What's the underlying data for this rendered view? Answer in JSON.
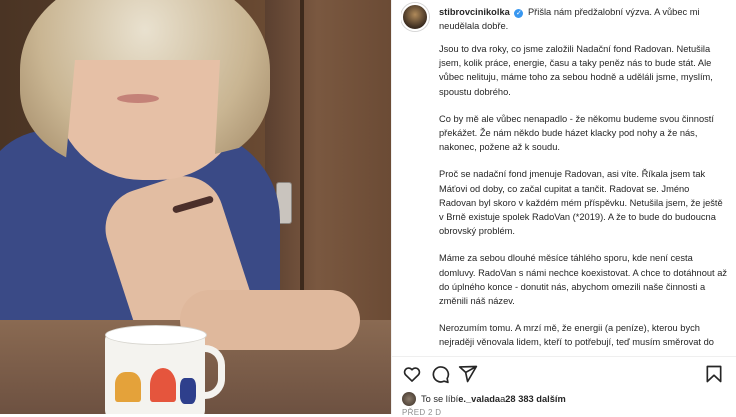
{
  "post": {
    "username": "stibrovcinikolka",
    "verified_icon": "verified-badge-icon",
    "caption_first": "Přišla nám předžalobní výzva. A vůbec mi neudělala dobře.",
    "paragraphs": [
      "Jsou to dva roky, co jsme založili Nadační fond Radovan. Netušila jsem, kolik práce, energie, času a taky peněz nás to bude stát. Ale vůbec nelituju, máme toho za sebou hodně a uděláli jsme, myslím, spoustu dobrého.",
      "Co by mě ale vůbec nenapadlo - že někomu budeme svou činností překážet. Že nám někdo bude házet klacky pod nohy a že nás, nakonec, požene až k soudu.",
      "Proč se nadační fond jmenuje Radovan, asi víte. Říkala jsem tak Máťovi od doby, co začal cupitat a tančit. Radovat se. Jméno Radovan byl skoro v každém mém příspěvku. Netušila jsem, že ještě v Brně existuje spolek RadoVan (*2019). A že to bude do budoucna obrovský problém.",
      "Máme za sebou dlouhé měsíce táhlého sporu, kde není cesta domluvy. RadoVan s námi nechce koexistovat. A chce to dotáhnout až do úplného konce - donutit nás, abychom omezili naše činnosti a změnili náš název.",
      "Nerozumím tomu. A mrzí mě, že energii (a peníze), kterou bych nejraději věnovala lidem, kteří to potřebují, teď musím směrovat do sporu, který je naprosto zbytečný. Dvě různé organizace, jak činností, tak formou, které každá svým způsobem pomáhají, přece nemůžou soupeřit. Vždyť si nekonkurujeme. Máme stejné cíle."
    ]
  },
  "actions": {
    "like_icon": "heart-icon",
    "comment_icon": "comment-icon",
    "share_icon": "share-icon",
    "save_icon": "bookmark-icon"
  },
  "likes": {
    "prefix": "To se líbí ",
    "user": "e._valada",
    "middle": " a ",
    "count": "28 383 dalším"
  },
  "timestamp": "PŘED 2 D",
  "colors": {
    "verified": "#3897f0",
    "text": "#262626",
    "muted": "#8e8e8e"
  }
}
